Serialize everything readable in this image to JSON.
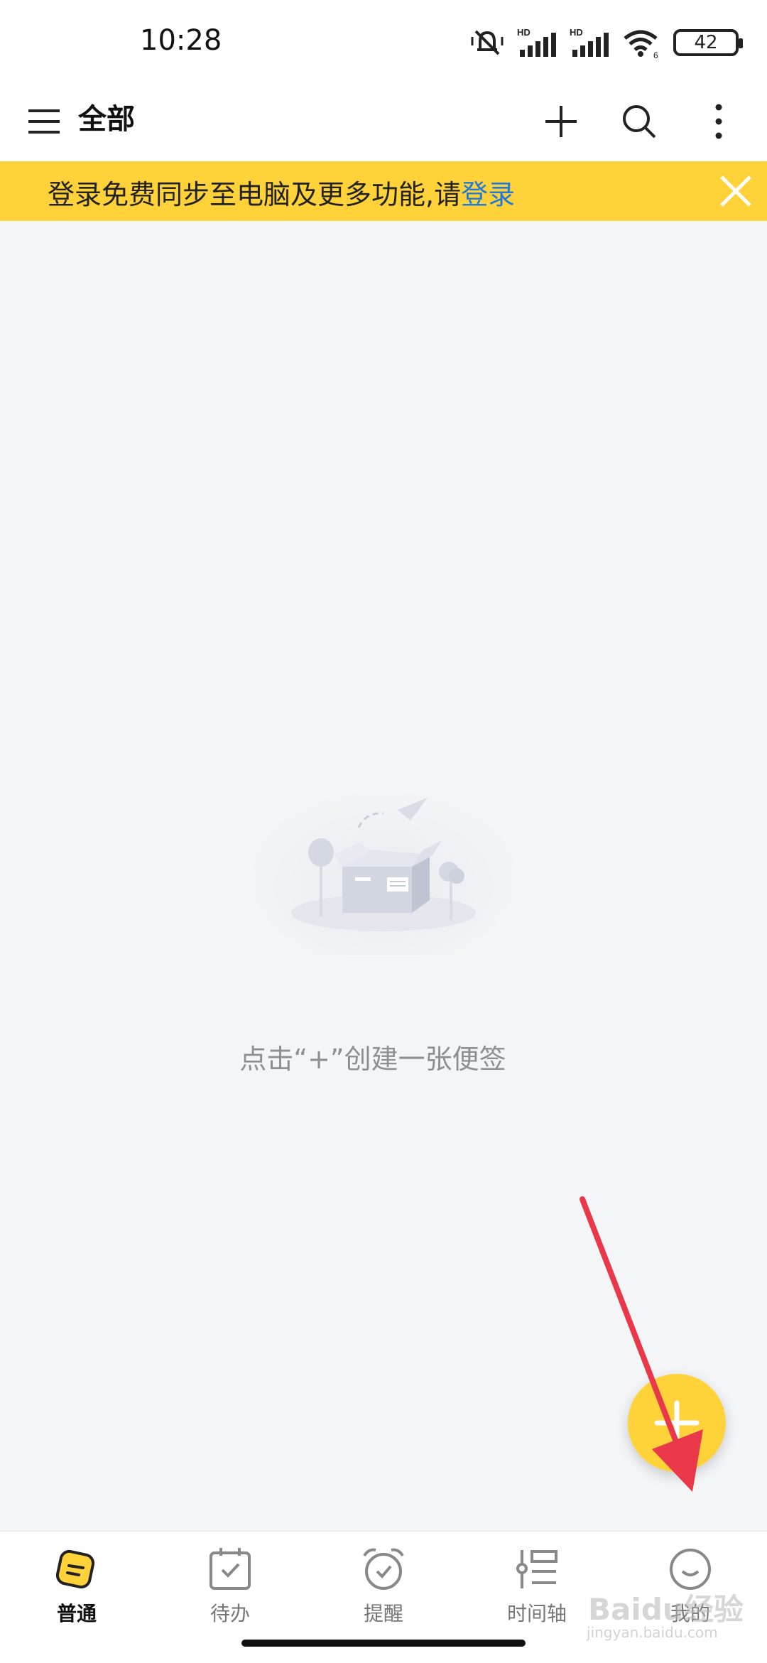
{
  "status_bar": {
    "time": "10:28",
    "battery": "42",
    "network_labels": [
      "HD",
      "HD"
    ]
  },
  "app_bar": {
    "title": "全部"
  },
  "banner": {
    "text": "登录免费同步至电脑及更多功能,请",
    "link": "登录"
  },
  "empty_state": {
    "text": "点击“+”创建一张便签"
  },
  "bottom_nav": {
    "items": [
      {
        "label": "普通",
        "icon": "note-icon",
        "active": true
      },
      {
        "label": "待办",
        "icon": "calendar-check-icon",
        "active": false
      },
      {
        "label": "提醒",
        "icon": "alarm-clock-icon",
        "active": false
      },
      {
        "label": "时间轴",
        "icon": "timeline-icon",
        "active": false
      },
      {
        "label": "我的",
        "icon": "smiley-icon",
        "active": false
      }
    ]
  },
  "watermark": {
    "text": "Baidu经验",
    "sub": "jingyan.baidu.com"
  },
  "colors": {
    "accent": "#ffd23a",
    "link": "#1f7bd6",
    "background": "#f4f5f7",
    "annotation_arrow": "#e8384a"
  }
}
